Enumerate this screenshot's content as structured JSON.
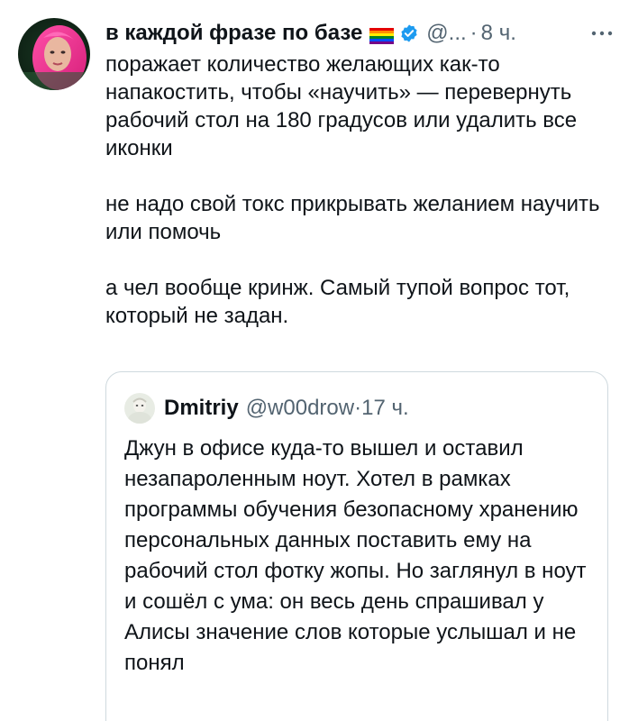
{
  "tweet": {
    "display_name": "в каждой фразе по базе",
    "handle": "@...",
    "separator": "·",
    "time": "8 ч.",
    "paragraphs": [
      "поражает количество желающих как-то напакостить, чтобы «научить» — перевернуть рабочий стол на 180 градусов или удалить все иконки",
      "не надо свой токс прикрывать желанием научить или помочь",
      "а чел вообще кринж. Самый тупой вопрос тот, который не задан."
    ],
    "icons": {
      "flag": "rainbow-flag-icon",
      "verified": "verified-badge-icon",
      "more": "more-options-icon"
    }
  },
  "quote": {
    "display_name": "Dmitriy",
    "handle": "@w00drow",
    "separator": "·",
    "time": "17 ч.",
    "text": "Джун в офисе куда-то вышел и оставил незапароленным ноут. Хотел в рамках программы обучения безопасному хранению персональных данных поставить ему на рабочий стол фотку жопы. Но заглянул в ноут и сошёл с ума: он весь день спрашивал у Алисы значение слов которые услышал и не понял"
  },
  "colors": {
    "text": "#0f1419",
    "secondary": "#536471",
    "verified": "#1d9bf0",
    "border": "#cfd9de"
  }
}
